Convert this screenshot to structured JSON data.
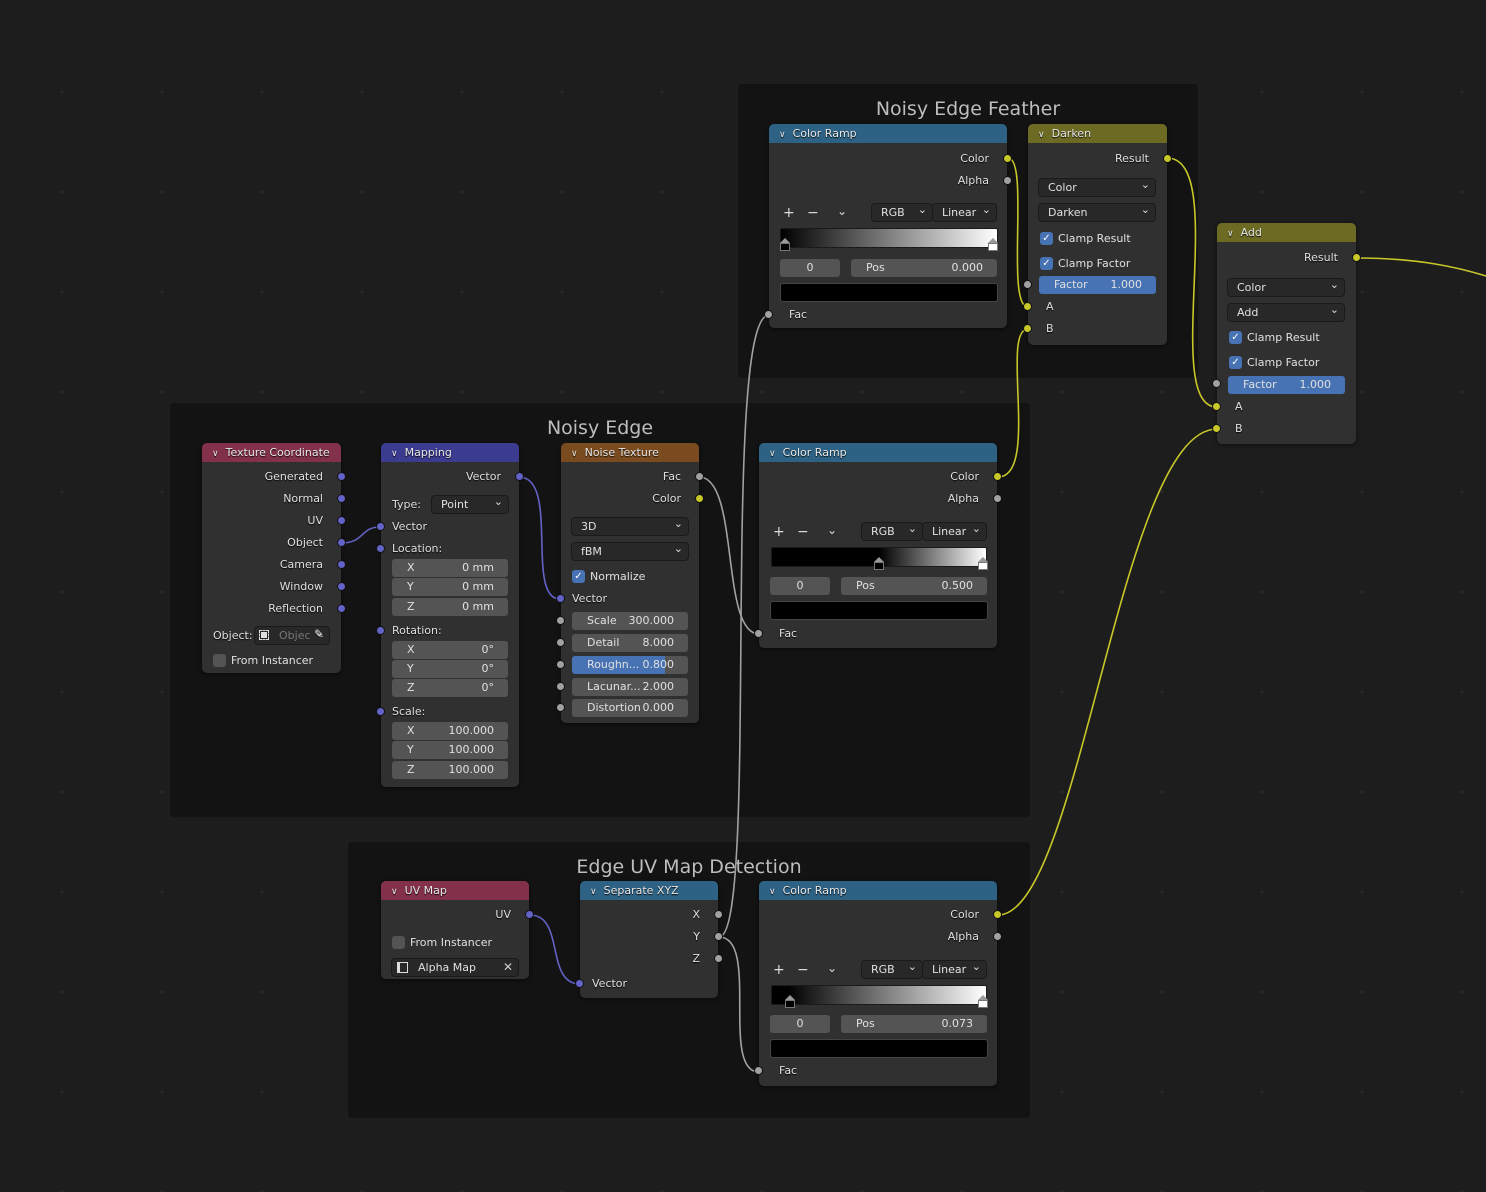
{
  "frames": {
    "feather": {
      "title": "Noisy Edge Feather"
    },
    "noisy": {
      "title": "Noisy Edge"
    },
    "uvdetect": {
      "title": "Edge UV Map Detection"
    }
  },
  "colors": {
    "header_converter": "#2e6284",
    "header_color": "#6c6a23",
    "header_input": "#83314a",
    "header_vector": "#3b3b8f",
    "header_texture": "#7a4b1e",
    "socket_color": "#c7c729",
    "socket_float": "#a1a1a1",
    "socket_vector": "#6363c7",
    "accent": "#4772b3"
  },
  "ramp1": {
    "title": "Color Ramp",
    "out_color": "Color",
    "out_alpha": "Alpha",
    "mode": "RGB",
    "interp": "Linear",
    "index": "0",
    "pos_label": "Pos",
    "pos_value": "0.000",
    "in_fac": "Fac"
  },
  "darken": {
    "title": "Darken",
    "out": "Result",
    "type": "Color",
    "blend": "Darken",
    "clamp_result": "Clamp Result",
    "clamp_factor": "Clamp Factor",
    "factor_label": "Factor",
    "factor_value": "1.000",
    "in_a": "A",
    "in_b": "B"
  },
  "add": {
    "title": "Add",
    "out": "Result",
    "type": "Color",
    "blend": "Add",
    "clamp_result": "Clamp Result",
    "clamp_factor": "Clamp Factor",
    "factor_label": "Factor",
    "factor_value": "1.000",
    "in_a": "A",
    "in_b": "B"
  },
  "texcoord": {
    "title": "Texture Coordinate",
    "outputs": [
      "Generated",
      "Normal",
      "UV",
      "Object",
      "Camera",
      "Window",
      "Reflection"
    ],
    "object_label": "Object:",
    "object_placeholder": "Objec",
    "from_instancer": "From Instancer"
  },
  "mapping": {
    "title": "Mapping",
    "out": "Vector",
    "type_label": "Type:",
    "type_value": "Point",
    "in_vector": "Vector",
    "location_label": "Location:",
    "location": [
      {
        "k": "X",
        "v": "0 mm"
      },
      {
        "k": "Y",
        "v": "0 mm"
      },
      {
        "k": "Z",
        "v": "0 mm"
      }
    ],
    "rotation_label": "Rotation:",
    "rotation": [
      {
        "k": "X",
        "v": "0°"
      },
      {
        "k": "Y",
        "v": "0°"
      },
      {
        "k": "Z",
        "v": "0°"
      }
    ],
    "scale_label": "Scale:",
    "scale": [
      {
        "k": "X",
        "v": "100.000"
      },
      {
        "k": "Y",
        "v": "100.000"
      },
      {
        "k": "Z",
        "v": "100.000"
      }
    ]
  },
  "noise": {
    "title": "Noise Texture",
    "out_fac": "Fac",
    "out_color": "Color",
    "dimensions": "3D",
    "type": "fBM",
    "normalize": "Normalize",
    "in_vector": "Vector",
    "fields": [
      {
        "k": "Scale",
        "v": "300.000"
      },
      {
        "k": "Detail",
        "v": "8.000"
      },
      {
        "k": "Roughn...",
        "v": "0.800"
      },
      {
        "k": "Lacunar...",
        "v": "2.000"
      },
      {
        "k": "Distortion",
        "v": "0.000"
      }
    ],
    "roughness_fraction": 0.8
  },
  "ramp2": {
    "title": "Color Ramp",
    "out_color": "Color",
    "out_alpha": "Alpha",
    "mode": "RGB",
    "interp": "Linear",
    "index": "0",
    "pos_label": "Pos",
    "pos_value": "0.500",
    "in_fac": "Fac"
  },
  "uvmap": {
    "title": "UV Map",
    "out": "UV",
    "from_instancer": "From Instancer",
    "map_name": "Alpha Map"
  },
  "sepxyz": {
    "title": "Separate XYZ",
    "outputs": [
      "X",
      "Y",
      "Z"
    ],
    "in_vector": "Vector"
  },
  "ramp3": {
    "title": "Color Ramp",
    "out_color": "Color",
    "out_alpha": "Alpha",
    "mode": "RGB",
    "interp": "Linear",
    "index": "0",
    "pos_label": "Pos",
    "pos_value": "0.073",
    "in_fac": "Fac"
  },
  "ramp_tools": {
    "add": "+",
    "remove": "−",
    "menu": "⌄"
  }
}
